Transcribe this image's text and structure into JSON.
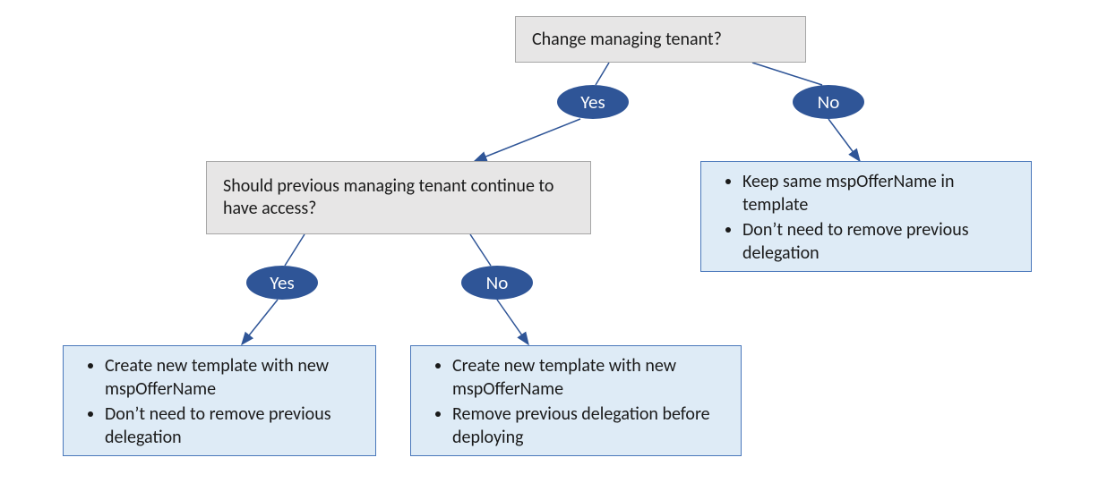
{
  "chart_data": {
    "type": "flowchart",
    "nodes": [
      {
        "id": "q1",
        "kind": "decision",
        "text": "Change managing tenant?"
      },
      {
        "id": "q1-yes",
        "kind": "label",
        "text": "Yes"
      },
      {
        "id": "q1-no",
        "kind": "label",
        "text": "No"
      },
      {
        "id": "q2",
        "kind": "decision",
        "text": "Should previous managing tenant continue to have access?"
      },
      {
        "id": "q2-yes",
        "kind": "label",
        "text": "Yes"
      },
      {
        "id": "q2-no",
        "kind": "label",
        "text": "No"
      },
      {
        "id": "out-yes-yes",
        "kind": "outcome",
        "bullets": [
          "Create new template with new mspOfferName",
          "Don’t need to remove previous delegation"
        ]
      },
      {
        "id": "out-yes-no",
        "kind": "outcome",
        "bullets": [
          "Create new template with new mspOfferName",
          "Remove previous delegation before deploying"
        ]
      },
      {
        "id": "out-no",
        "kind": "outcome",
        "bullets": [
          "Keep same mspOfferName in template",
          "Don’t need to remove previous delegation"
        ]
      }
    ],
    "edges": [
      {
        "from": "q1",
        "to": "q2",
        "label": "Yes"
      },
      {
        "from": "q1",
        "to": "out-no",
        "label": "No"
      },
      {
        "from": "q2",
        "to": "out-yes-yes",
        "label": "Yes"
      },
      {
        "from": "q2",
        "to": "out-yes-no",
        "label": "No"
      }
    ]
  },
  "q1_text": "Change managing tenant?",
  "q2_text": "Should previous managing tenant continue to have access?",
  "yes": "Yes",
  "no": "No",
  "out_yes_yes": {
    "b1": "Create new template with new mspOfferName",
    "b2": "Don’t need to remove previous delegation"
  },
  "out_yes_no": {
    "b1": "Create new template with new mspOfferName",
    "b2": "Remove previous delegation before deploying"
  },
  "out_no": {
    "b1": "Keep same mspOfferName in template",
    "b2": "Don’t need to remove previous delegation"
  }
}
